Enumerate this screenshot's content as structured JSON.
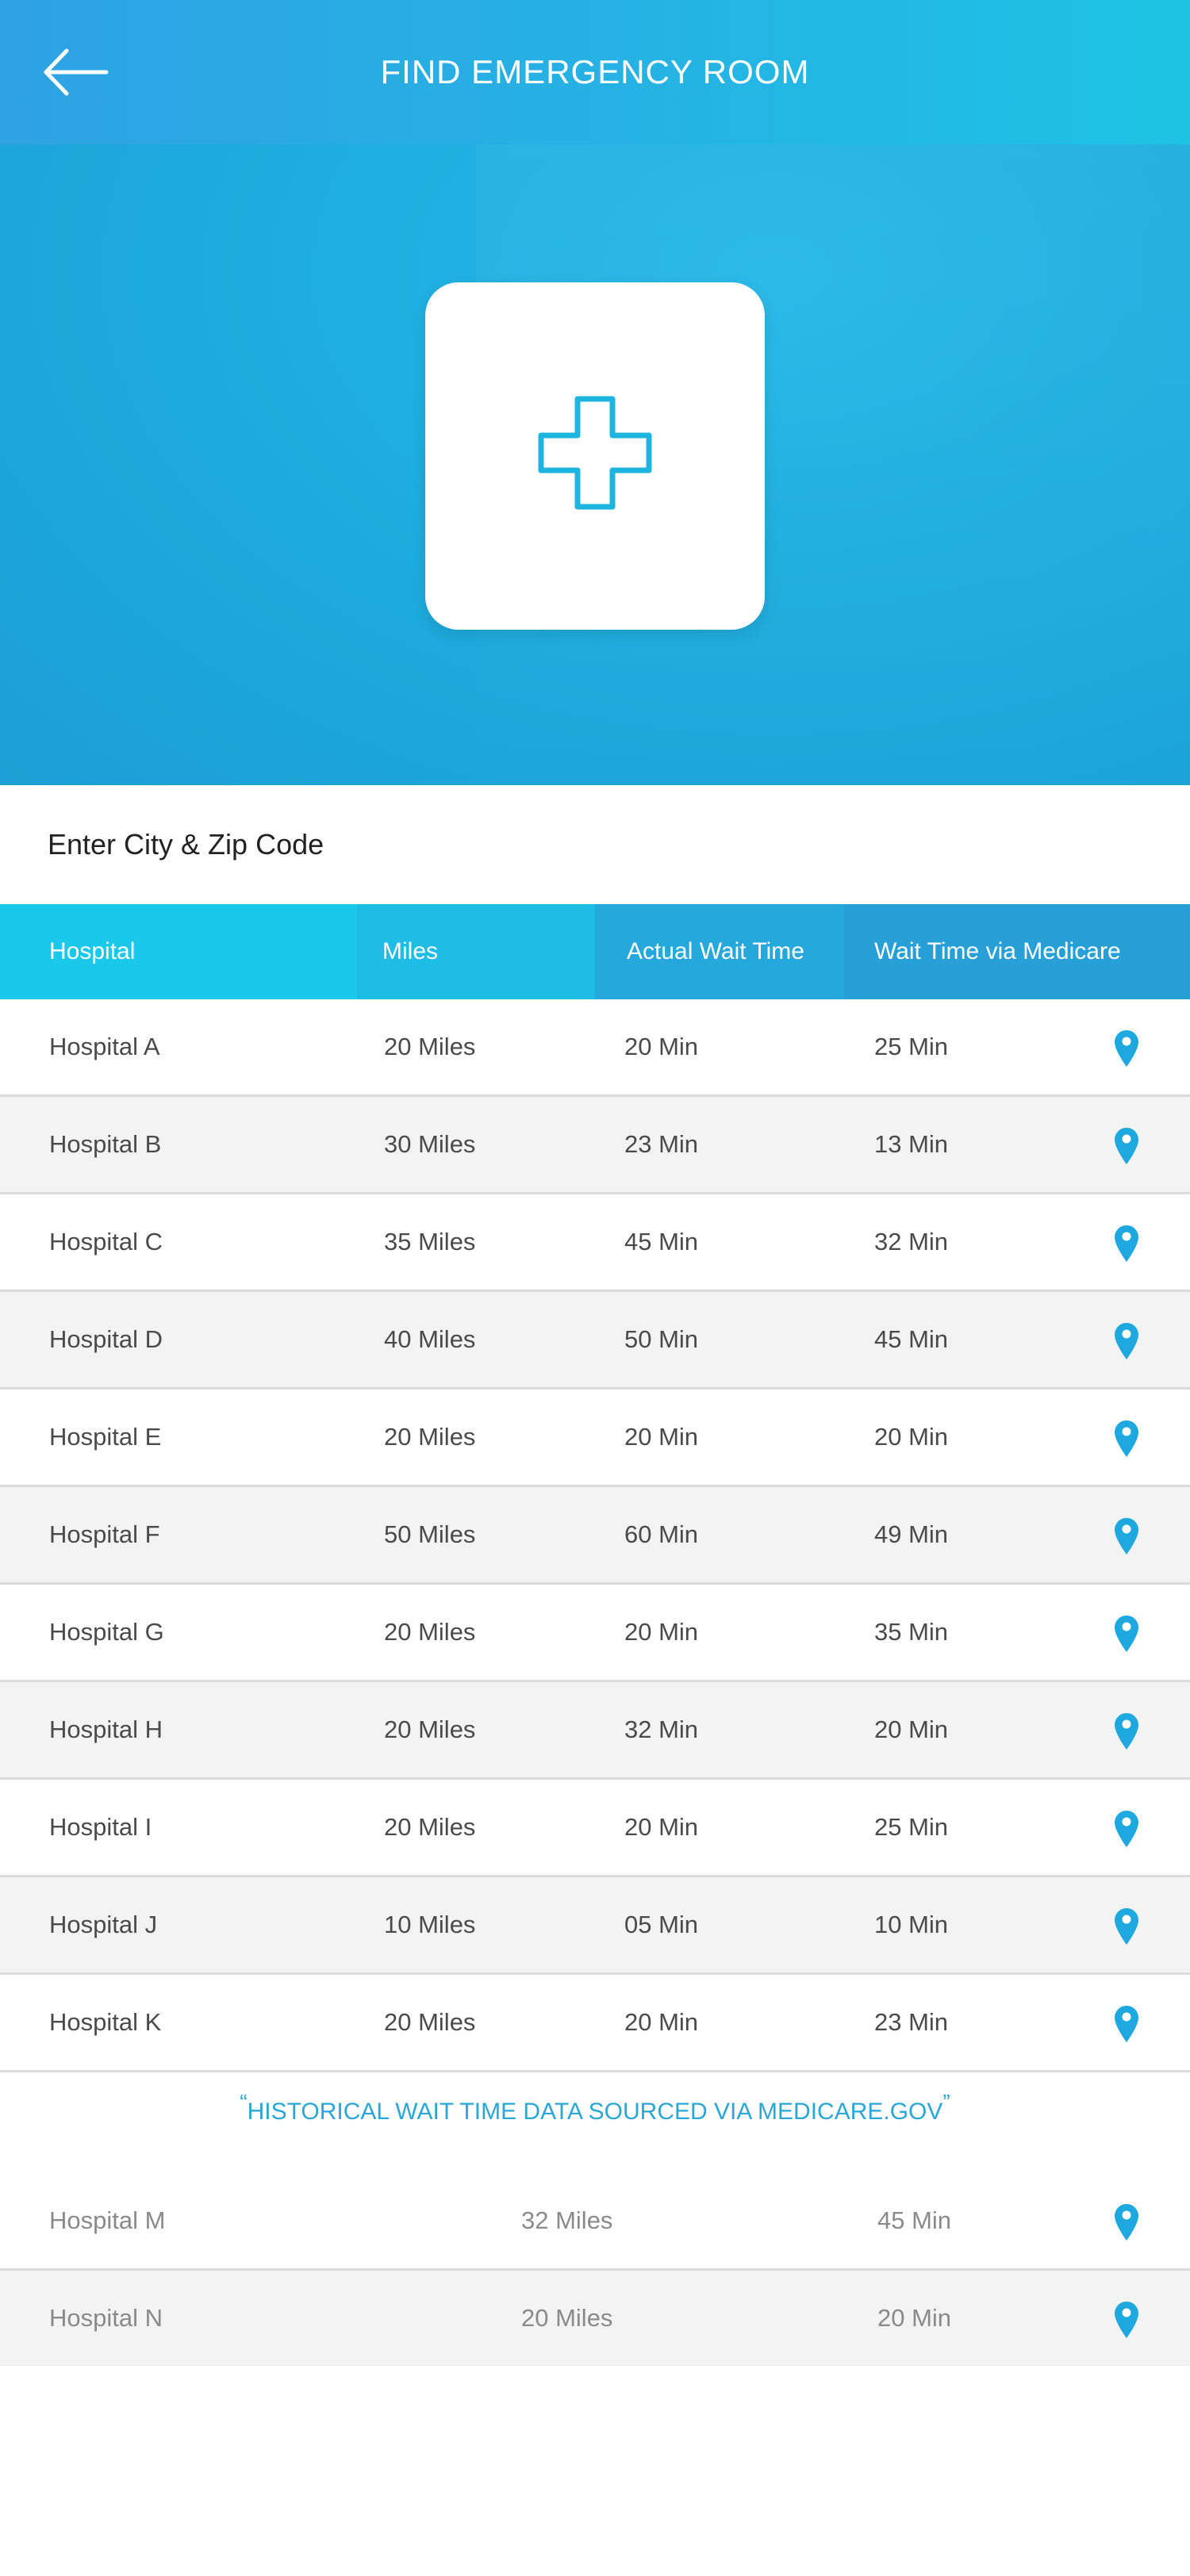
{
  "header": {
    "title": "FIND EMERGENCY ROOM",
    "back_icon": "arrow-left-icon"
  },
  "hero": {
    "icon": "medical-cross-icon",
    "accent": "#1db4e0"
  },
  "search": {
    "placeholder": "Enter City & Zip Code"
  },
  "table": {
    "headers": {
      "hospital": "Hospital",
      "miles": "Miles",
      "actual_wait": "Actual Wait Time",
      "medicare_wait": "Wait Time via Medicare"
    },
    "header_colors": [
      "#1ac8ec",
      "#1dbde5",
      "#25a8dc",
      "#279fd7"
    ],
    "rows": [
      {
        "hospital": "Hospital A",
        "miles": "20 Miles",
        "actual": "20 Min",
        "medicare": "25 Min"
      },
      {
        "hospital": "Hospital B",
        "miles": "30 Miles",
        "actual": "23 Min",
        "medicare": "13 Min"
      },
      {
        "hospital": "Hospital C",
        "miles": "35 Miles",
        "actual": "45 Min",
        "medicare": "32 Min"
      },
      {
        "hospital": "Hospital D",
        "miles": "40 Miles",
        "actual": "50 Min",
        "medicare": "45 Min"
      },
      {
        "hospital": "Hospital E",
        "miles": "20 Miles",
        "actual": "20 Min",
        "medicare": "20 Min"
      },
      {
        "hospital": "Hospital F",
        "miles": "50 Miles",
        "actual": "60 Min",
        "medicare": "49 Min"
      },
      {
        "hospital": "Hospital G",
        "miles": "20 Miles",
        "actual": "20 Min",
        "medicare": "35 Min"
      },
      {
        "hospital": "Hospital H",
        "miles": "20 Miles",
        "actual": "32 Min",
        "medicare": "20 Min"
      },
      {
        "hospital": "Hospital I",
        "miles": "20 Miles",
        "actual": "20 Min",
        "medicare": "25 Min"
      },
      {
        "hospital": "Hospital J",
        "miles": "10 Miles",
        "actual": "05 Min",
        "medicare": "10 Min"
      },
      {
        "hospital": "Hospital K",
        "miles": "20 Miles",
        "actual": "20 Min",
        "medicare": "23 Min"
      }
    ],
    "pin_icon": "map-pin-icon",
    "pin_color": "#1ea8e0"
  },
  "note": {
    "open_quote": "“",
    "text": "HISTORICAL WAIT TIME DATA SOURCED VIA MEDICARE.GOV",
    "close_quote": "”"
  },
  "secondary_rows": [
    {
      "hospital": "Hospital M",
      "miles": "32 Miles",
      "wait": "45 Min"
    },
    {
      "hospital": "Hospital N",
      "miles": "20 Miles",
      "wait": "20 Min"
    }
  ]
}
